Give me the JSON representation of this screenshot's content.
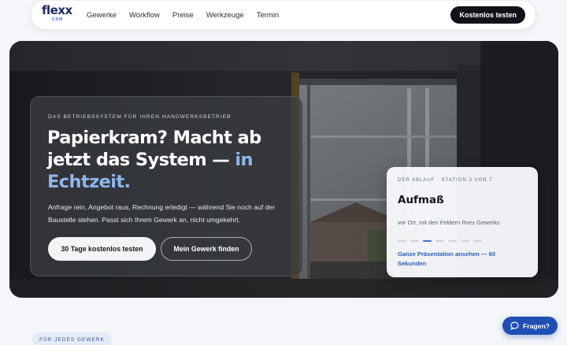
{
  "nav": {
    "logo_text": "flexx",
    "logo_sub": "CRM",
    "links": [
      "Gewerke",
      "Workflow",
      "Preise",
      "Werkzeuge",
      "Termin"
    ],
    "cta": "Kostenlos testen"
  },
  "hero": {
    "eyebrow": "DAS BETRIEBSSYSTEM FÜR IHREN HANDWERKSBETRIEB",
    "headline_main": "Papierkram? Macht ab jetzt das System —",
    "headline_accent": "in Echtzeit.",
    "lede": "Anfrage rein, Angebot raus, Rechnung erledigt — während Sie noch auf der Baustelle stehen. Passt sich Ihrem Gewerk an, nicht umgekehrt.",
    "primary_button": "30 Tage kostenlos testen",
    "secondary_button": "Mein Gewerk finden"
  },
  "station": {
    "eyebrow": "DER ABLAUF · STATION 3 VON 7",
    "title": "Aufmaß",
    "description": "vor Ort, mit den Feldern Ihres Gewerks",
    "progress": {
      "current": 3,
      "total": 7
    },
    "link": "Ganze Präsentation ansehen — 60 Sekunden"
  },
  "section_tag": "FÜR JEDES GEWERK",
  "chat": {
    "label": "Fragen?",
    "icon": "chat-bubble-icon"
  },
  "colors": {
    "accent": "#3d6fd6",
    "accent_light": "#8fb6ea",
    "nav_cta_bg": "#111318",
    "chat_bg": "#1f4fb4"
  }
}
